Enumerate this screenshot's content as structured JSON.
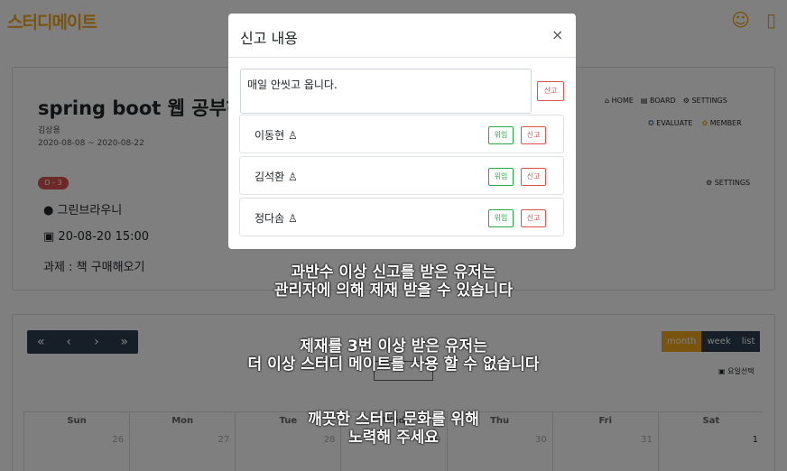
{
  "brand": "스터디메이트",
  "study": {
    "title": "spring boot 웹 공부하",
    "author": "김상용",
    "dates": "2020-08-08 ~ 2020-08-22",
    "dday": "D - 3",
    "location": "그린브라우니",
    "time": "20-08-20 15:00",
    "task": "과제 : 책 구매해오기"
  },
  "nav": {
    "home": "HOME",
    "board": "BOARD",
    "settings": "SETTINGS",
    "evaluate": "EVALUATE",
    "member": "MEMBER",
    "settings2": "SETTINGS"
  },
  "calendar": {
    "pager": [
      "«",
      "‹",
      "›",
      "»"
    ],
    "views": [
      "month",
      "week",
      "list"
    ],
    "picker": "요일선택",
    "days": [
      "Sun",
      "Mon",
      "Tue",
      "Wed",
      "Thu",
      "Fri",
      "Sat"
    ],
    "dates": [
      "26",
      "27",
      "28",
      "29",
      "30",
      "31",
      "1"
    ]
  },
  "modal": {
    "title": "신고 내용",
    "close": "×",
    "reason": "매일 안씻고 옵니다.",
    "report_btn": "신고",
    "members": [
      {
        "name": "이동현",
        "warn": "위임",
        "report": "신고"
      },
      {
        "name": "김석환",
        "warn": "위임",
        "report": "신고"
      },
      {
        "name": "정다솜",
        "warn": "위임",
        "report": "신고"
      }
    ]
  },
  "notice": {
    "line1": "과반수 이상 신고를 받은 유저는",
    "line2": "관리자에 의해 제재 받을 수 있습니다",
    "line3": "제재를 3번 이상 받은 유저는",
    "line4": "더 이상 스터디 메이트를 사용 할 수 없습니다",
    "line5": "깨끗한 스터디 문화를 위해",
    "line6": "노력해 주세요"
  }
}
